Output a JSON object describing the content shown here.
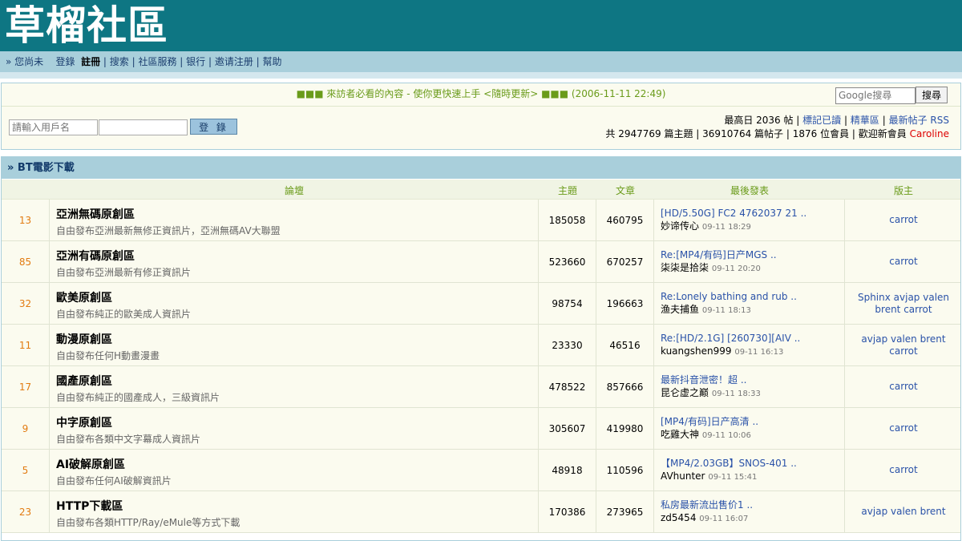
{
  "header": {
    "logo": "草榴社區"
  },
  "nav": {
    "prefix": "» 您尚未",
    "login": "登錄",
    "register": "註冊",
    "items": [
      "搜索",
      "社區服務",
      "银行",
      "邀请注册",
      "幫助"
    ]
  },
  "notice": "■■■ 來訪者必看的內容 - 使你更快速上手 <隨時更新> ■■■ (2006-11-11 22:49)",
  "google": {
    "placeholder": "Google搜尋",
    "button": "搜尋"
  },
  "login": {
    "username_placeholder": "請輸入用戶名",
    "button": "登 錄"
  },
  "stats": {
    "line1_prefix": "最高日 2036 帖 |",
    "mark_read": "標記已讀",
    "sep1": "|",
    "featured": "精華區",
    "sep2": "|",
    "latest_rss": "最新帖子 RSS",
    "line2": "共 2947769 篇主題 | 36910764 篇帖子 | 1876 位會員 | 歡迎新會員",
    "new_member": "Caroline"
  },
  "category": {
    "title": "» BT電影下載"
  },
  "columns": {
    "forum": "論壇",
    "topics": "主題",
    "posts": "文章",
    "last_post": "最後發表",
    "moderator": "版主"
  },
  "forums": [
    {
      "today": "13",
      "name": "亞洲無碼原創區",
      "desc": "自由發布亞洲最新無修正資訊片，亞洲無碼AV大聯盟",
      "topics": "185058",
      "posts": "460795",
      "last_title": "[HD/5.50G] FC2 4762037 21 ..",
      "last_user": "妙谛传心",
      "last_date": "09-11 18:29",
      "mods": "carrot"
    },
    {
      "today": "85",
      "name": "亞洲有碼原創區",
      "desc": "自由發布亞洲最新有修正資訊片",
      "topics": "523660",
      "posts": "670257",
      "last_title": "Re:[MP4/有码]日产MGS ..",
      "last_user": "柒柒是拾柒",
      "last_date": "09-11 20:20",
      "mods": "carrot"
    },
    {
      "today": "32",
      "name": "歐美原創區",
      "desc": "自由發布純正的歐美成人資訊片",
      "topics": "98754",
      "posts": "196663",
      "last_title": "Re:Lonely bathing and rub ..",
      "last_user": "渔夫捕鱼",
      "last_date": "09-11 18:13",
      "mods": "Sphinx avjap valen brent carrot"
    },
    {
      "today": "11",
      "name": "動漫原創區",
      "desc": "自由發布任何H動畫漫畫",
      "topics": "23330",
      "posts": "46516",
      "last_title": "Re:[HD/2.1G] [260730][AIV ..",
      "last_user": "kuangshen999",
      "last_date": "09-11 16:13",
      "mods": "avjap valen brent carrot"
    },
    {
      "today": "17",
      "name": "國產原創區",
      "desc": "自由發布純正的國產成人，三級資訊片",
      "topics": "478522",
      "posts": "857666",
      "last_title": "最新抖音泄密！超 ..",
      "last_user": "昆仑虚之巅",
      "last_date": "09-11 18:33",
      "mods": "carrot"
    },
    {
      "today": "9",
      "name": "中字原創區",
      "desc": "自由發布各類中文字幕成人資訊片",
      "topics": "305607",
      "posts": "419980",
      "last_title": "[MP4/有码]日产高清 ..",
      "last_user": "吃雞大神",
      "last_date": "09-11 10:06",
      "mods": "carrot"
    },
    {
      "today": "5",
      "name": "AI破解原創區",
      "desc": "自由發布任何AI破解資訊片",
      "topics": "48918",
      "posts": "110596",
      "last_title": "【MP4/2.03GB】SNOS-401 ..",
      "last_user": "AVhunter",
      "last_date": "09-11 15:41",
      "mods": "carrot"
    },
    {
      "today": "23",
      "name": "HTTP下載區",
      "desc": "自由發布各類HTTP/Ray/eMule等方式下載",
      "topics": "170386",
      "posts": "273965",
      "last_title": "私房最新流出售价1 ..",
      "last_user": "zd5454",
      "last_date": "09-11 16:07",
      "mods": "avjap valen brent"
    }
  ]
}
